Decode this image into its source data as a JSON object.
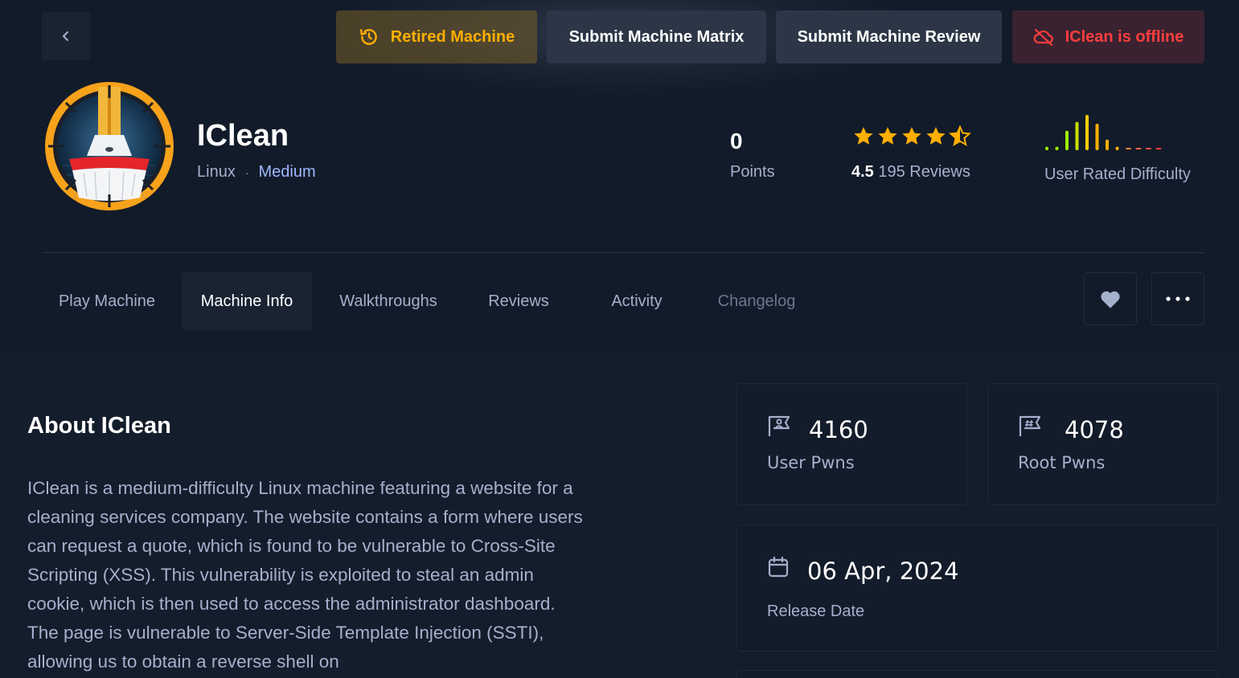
{
  "header": {
    "buttons": {
      "retired": "Retired Machine",
      "matrix": "Submit Machine Matrix",
      "review": "Submit Machine Review",
      "offline": "IClean is offline"
    },
    "machine": {
      "name": "IClean",
      "os": "Linux",
      "separator": "·",
      "difficulty": "Medium",
      "avatar_icon": "broom-machine-avatar"
    },
    "stats": {
      "points_value": "0",
      "points_label": "Points",
      "rating_value": "4.5",
      "rating_stars": 4.5,
      "reviews": "195 Reviews",
      "difficulty_label": "User Rated Difficulty",
      "difficulty_bars": [
        0.1,
        0.1,
        0.55,
        0.8,
        1.0,
        0.75,
        0.3,
        0.1,
        0.03,
        0.03,
        0.03,
        0.03
      ]
    }
  },
  "tabs": [
    {
      "label": "Play Machine"
    },
    {
      "label": "Machine Info"
    },
    {
      "label": "Walkthroughs"
    },
    {
      "label": "Reviews"
    },
    {
      "label": "Activity"
    },
    {
      "label": "Changelog"
    }
  ],
  "about": {
    "title": "About IClean",
    "text": "IClean is a medium-difficulty Linux machine featuring a website for a cleaning services company. The website contains a form where users can request a quote, which is found to be vulnerable to Cross-Site Scripting (XSS). This vulnerability is exploited to steal an admin cookie, which is then used to access the administrator dashboard. The page is vulnerable to Server-Side Template Injection (SSTI), allowing us to obtain a reverse shell on"
  },
  "cards": {
    "user_pwns_value": "4160",
    "user_pwns_label": "User Pwns",
    "root_pwns_value": "4078",
    "root_pwns_label": "Root Pwns",
    "release_date_value": "06 Apr, 2024",
    "release_date_label": "Release Date"
  },
  "colors": {
    "background": "#141d2b",
    "retired": "#ffaf00",
    "offline": "#ff3e3e",
    "difficulty_link": "#9fb7ff",
    "star": "#ffaf00",
    "easy_green": "#9fef00"
  }
}
